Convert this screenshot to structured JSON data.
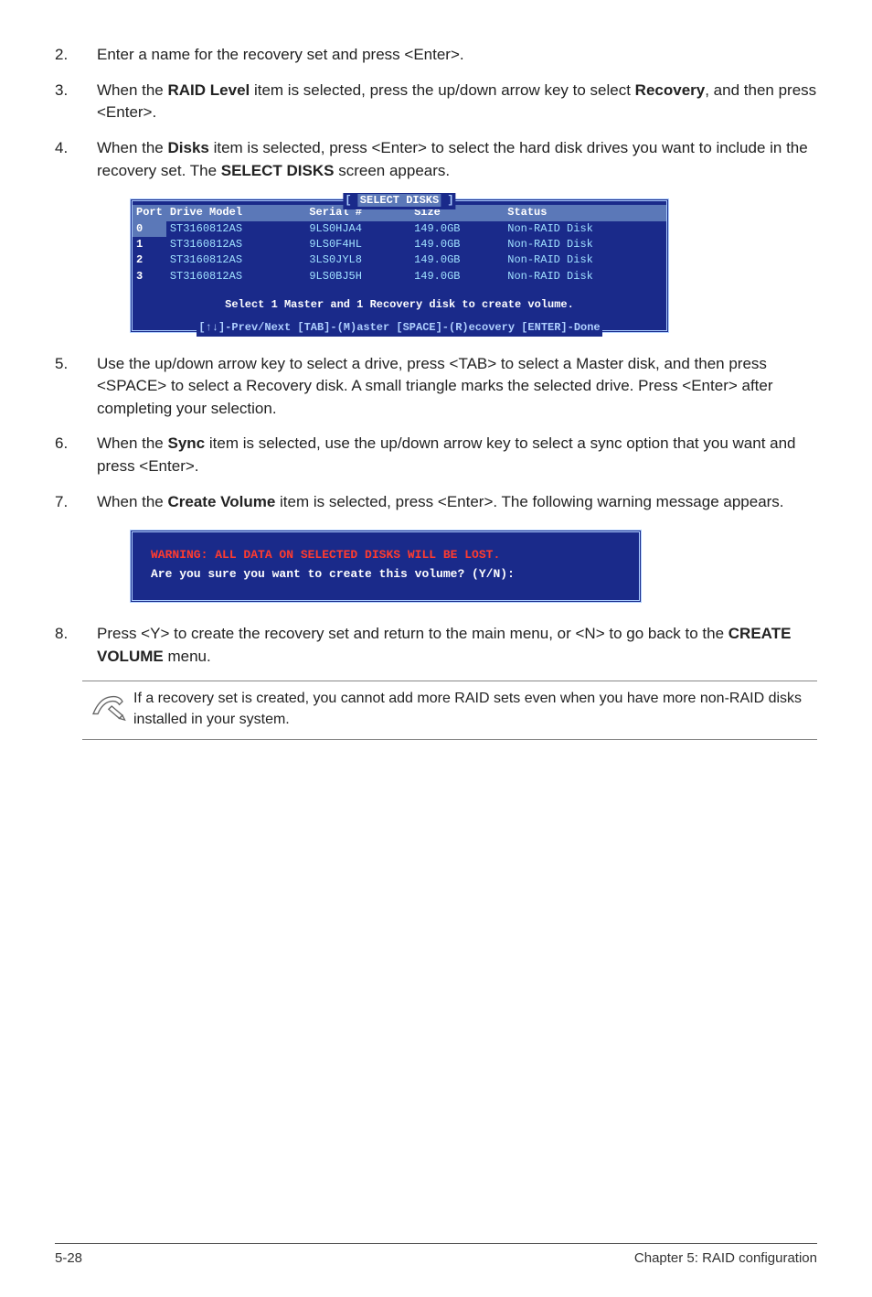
{
  "steps_a": [
    {
      "num": "2.",
      "text_pre": "Enter a name for the recovery set and press <Enter>."
    },
    {
      "num": "3.",
      "text_pre": "When the ",
      "b1": "RAID Level",
      "mid": " item is selected, press the up/down arrow key to select ",
      "b2": "Recovery",
      "text_post": ", and then press <Enter>."
    },
    {
      "num": "4.",
      "text_pre": "When the ",
      "b1": "Disks",
      "mid": " item is selected, press <Enter> to select the hard disk drives you want to include in the recovery set. The ",
      "b2": "SELECT DISKS",
      "text_post": " screen appears."
    }
  ],
  "terminal": {
    "title": "SELECT DISKS",
    "headers": [
      "Port",
      "Drive Model",
      "Serial #",
      "Size",
      "Status"
    ],
    "rows": [
      {
        "port": "0",
        "model": "ST3160812AS",
        "serial": "9LS0HJA4",
        "size": "149.0GB",
        "status": "Non-RAID Disk",
        "sel": true
      },
      {
        "port": "1",
        "model": "ST3160812AS",
        "serial": "9LS0F4HL",
        "size": "149.0GB",
        "status": "Non-RAID Disk"
      },
      {
        "port": "2",
        "model": "ST3160812AS",
        "serial": "3LS0JYL8",
        "size": "149.0GB",
        "status": "Non-RAID Disk"
      },
      {
        "port": "3",
        "model": "ST3160812AS",
        "serial": "9LS0BJ5H",
        "size": "149.0GB",
        "status": "Non-RAID Disk"
      }
    ],
    "message": "Select 1 Master and 1 Recovery disk to create volume.",
    "footer": "[↑↓]-Prev/Next [TAB]-(M)aster [SPACE]-(R)ecovery [ENTER]-Done"
  },
  "steps_b": [
    {
      "num": "5.",
      "text": "Use the up/down arrow key to select a drive, press <TAB> to select a Master disk, and then press <SPACE> to select a Recovery disk. A small triangle marks the selected drive. Press <Enter> after completing your selection."
    },
    {
      "num": "6.",
      "text_pre": "When the ",
      "b1": "Sync",
      "text_post": " item is selected, use the up/down arrow key to select a sync option that you want and press <Enter>."
    },
    {
      "num": "7.",
      "text_pre": "When the ",
      "b1": "Create Volume",
      "text_post": " item is selected, press <Enter>. The following warning message appears."
    }
  ],
  "warning": {
    "line1": "WARNING: ALL DATA ON SELECTED DISKS WILL BE LOST.",
    "line2": "Are you sure you want to create this volume? (Y/N):"
  },
  "step8": {
    "num": "8.",
    "pre": "Press <Y> to create the recovery set and return to the main menu, or <N> to go back to the ",
    "b": "CREATE VOLUME",
    "post": " menu."
  },
  "note": "If a recovery set is created, you cannot add more RAID sets even when you have more non-RAID disks installed in your system.",
  "footer": {
    "left": "5-28",
    "right": "Chapter 5: RAID configuration"
  }
}
